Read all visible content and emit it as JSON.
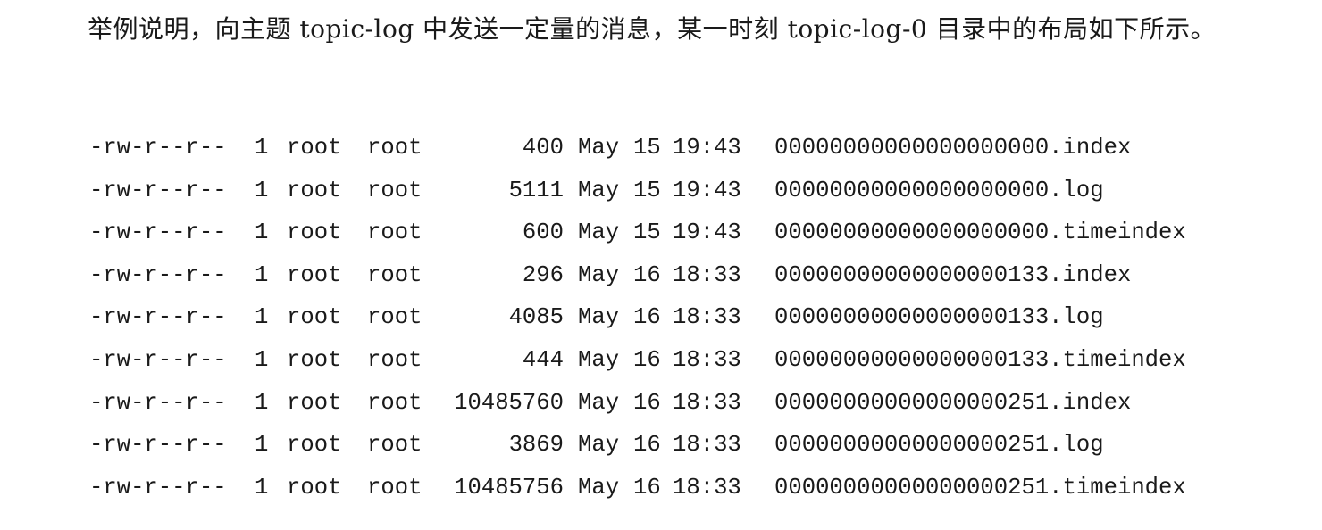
{
  "intro_text": "举例说明，向主题 topic-log 中发送一定量的消息，某一时刻 topic-log-0 目录中的布局如下所示。",
  "listing": [
    {
      "perm": "-rw-r--r--",
      "links": "1",
      "owner": "root",
      "group": "root",
      "size": "400",
      "month": "May",
      "day": "15",
      "time": "19:43",
      "name": "00000000000000000000.index"
    },
    {
      "perm": "-rw-r--r--",
      "links": "1",
      "owner": "root",
      "group": "root",
      "size": "5111",
      "month": "May",
      "day": "15",
      "time": "19:43",
      "name": "00000000000000000000.log"
    },
    {
      "perm": "-rw-r--r--",
      "links": "1",
      "owner": "root",
      "group": "root",
      "size": "600",
      "month": "May",
      "day": "15",
      "time": "19:43",
      "name": "00000000000000000000.timeindex"
    },
    {
      "perm": "-rw-r--r--",
      "links": "1",
      "owner": "root",
      "group": "root",
      "size": "296",
      "month": "May",
      "day": "16",
      "time": "18:33",
      "name": "00000000000000000133.index"
    },
    {
      "perm": "-rw-r--r--",
      "links": "1",
      "owner": "root",
      "group": "root",
      "size": "4085",
      "month": "May",
      "day": "16",
      "time": "18:33",
      "name": "00000000000000000133.log"
    },
    {
      "perm": "-rw-r--r--",
      "links": "1",
      "owner": "root",
      "group": "root",
      "size": "444",
      "month": "May",
      "day": "16",
      "time": "18:33",
      "name": "00000000000000000133.timeindex"
    },
    {
      "perm": "-rw-r--r--",
      "links": "1",
      "owner": "root",
      "group": "root",
      "size": "10485760",
      "month": "May",
      "day": "16",
      "time": "18:33",
      "name": "00000000000000000251.index"
    },
    {
      "perm": "-rw-r--r--",
      "links": "1",
      "owner": "root",
      "group": "root",
      "size": "3869",
      "month": "May",
      "day": "16",
      "time": "18:33",
      "name": "00000000000000000251.log"
    },
    {
      "perm": "-rw-r--r--",
      "links": "1",
      "owner": "root",
      "group": "root",
      "size": "10485756",
      "month": "May",
      "day": "16",
      "time": "18:33",
      "name": "00000000000000000251.timeindex"
    }
  ]
}
